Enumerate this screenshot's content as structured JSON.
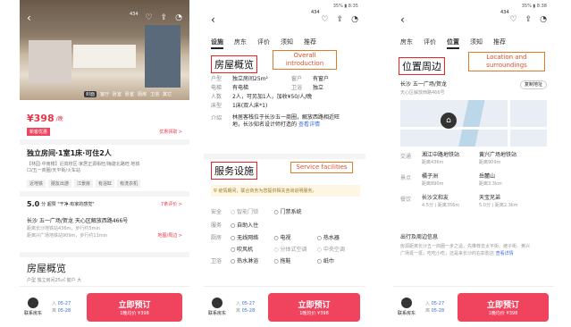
{
  "status": {
    "p2": "35% ▮ 8:35",
    "p3": "35% ▮ 8:38"
  },
  "p1": {
    "photo_count": "434",
    "photo_tabs": [
      "封面",
      "客厅",
      "卧室",
      "卧室",
      "厨房",
      "卫浴",
      "其它"
    ],
    "price": "¥398",
    "price_unit": "/晚",
    "promo_tag": "新客优惠",
    "promo_link": "优惠领取 >",
    "title": "独立房间·1室1床·可住2人",
    "tags_line1": "【林园·中南楼】近高校区·家居正源街旺/梅建北路旺·地铁",
    "tags_line2": "口/五一商圈/天平街/火车站",
    "chips": [
      "近地铁",
      "朋友出游",
      "江景房",
      "有浴缸",
      "有洗衣机"
    ],
    "rating": "5.0",
    "rating_sub": "分  超赞 \"干净·有家的感觉\"",
    "reviews_link": "7条评价 >",
    "addr": "长沙 五一广场/贺龙 天心区解放西路466号",
    "addr_sub1": "距离长沙地铁站436m，步行约5min",
    "addr_sub2": "距离兴广场地铁站909m，步行约11min",
    "map_link": "地图/周边 >",
    "section": "房屋概览",
    "overview_sub": "户型  独立房间25㎡     窗户  大"
  },
  "p2": {
    "photo_count": "434",
    "tabs": [
      "设施",
      "房东",
      "评价",
      "须知",
      "推荐"
    ],
    "overview_title": "房屋概览",
    "callout1": "Overall introduction",
    "rows": [
      {
        "k": "户型",
        "v": "独立房间25m²",
        "k2": "窗户",
        "v2": "有窗户"
      },
      {
        "k": "电梯",
        "v": "有电梯",
        "k2": "卫浴",
        "v2": "独立"
      },
      {
        "k": "人数",
        "v": "2人，可另加1人，加收¥50/人/晚",
        "k2": "",
        "v2": ""
      },
      {
        "k": "床型",
        "v": "1床(双人床*1)",
        "k2": "",
        "v2": ""
      }
    ],
    "intro_k": "介绍",
    "intro_v1": "林居客栈位于长沙五一商圈，解放西路相近旺",
    "intro_v2": "地，长沙知名设计师打造的",
    "intro_link": "查看详情",
    "facility_title": "服务设施",
    "callout2": "Service facilities",
    "notice": "疫情期间，联合商务为您提供相关咨询说明服务。",
    "fac": [
      {
        "k": "安全",
        "items": [
          "智能门锁",
          "门禁系统"
        ]
      },
      {
        "k": "服务",
        "items": [
          "自助入住"
        ]
      },
      {
        "k": "厨房",
        "items": [
          "无线网络",
          "电视",
          "热水器"
        ]
      },
      {
        "k": "",
        "items": [
          "吹风机",
          "分体式空调",
          "中央空调"
        ]
      },
      {
        "k": "卫浴",
        "items": [
          "热水淋浴",
          "拖鞋",
          "纸巾"
        ]
      }
    ],
    "contact": "联系房东",
    "in_label": "入",
    "in_date": "05-27",
    "out_label": "离",
    "out_date": "05-28",
    "book": "立即预订",
    "book_sub": "1晚均价 ¥398"
  },
  "p3": {
    "photo_count": "434",
    "tabs": [
      "房东",
      "评价",
      "位置",
      "须知",
      "推荐"
    ],
    "loc_title": "位置周边",
    "callout3": "Location and surroundings",
    "addr": "长沙 五一广场/贺龙",
    "addr_sub": "天心区解放西路466号",
    "copy_btn": "复制地址",
    "map_label1": "江天阁",
    "traffic": [
      {
        "k": "交通",
        "n1": "湘江中路地铁站",
        "d1": "距离436m",
        "n2": "黄兴广场地铁站",
        "d2": "距离909m"
      },
      {
        "k": "景点",
        "n1": "橘子洲",
        "d1": "距离890m",
        "n2": "岳麓山",
        "d2": "距离3.3km"
      },
      {
        "k": "餐饮",
        "n1": "长沙文和友",
        "d1": "4.5分 | 距离356m",
        "n2": "天宝兄弟",
        "d2": "5.0分 | 距离2.3km"
      }
    ],
    "transport_title": "出行及周边信息",
    "transport_v1": "房源距离长沙五一商圈一步之遥，先推荐去太平街、坡子街、黄兴",
    "transport_v2": "广场逛一逛，吃吃小吃，还是来长沙的右彰影店",
    "transport_link": "查看详情",
    "contact": "联系房东",
    "in_label": "入",
    "in_date": "05-27",
    "out_label": "离",
    "out_date": "05-28",
    "book": "立即预订",
    "book_sub": "1晚均价 ¥398"
  },
  "colors": {
    "accent": "#f0435e",
    "callout": "#e07b2a",
    "highlight": "#e22222"
  }
}
